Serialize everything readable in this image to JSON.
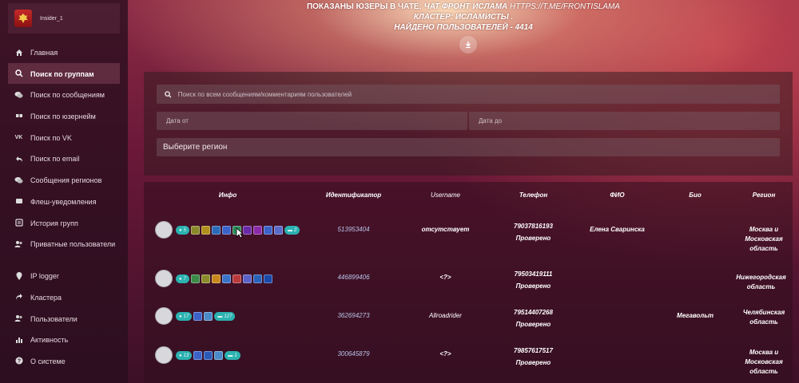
{
  "user": {
    "name": "Insider_1"
  },
  "sidebar": {
    "items": [
      {
        "label": "Главная",
        "icon": "home-icon"
      },
      {
        "label": "Поиск по группам",
        "icon": "search-icon",
        "active": true
      },
      {
        "label": "Поиск по сообщениям",
        "icon": "comments-icon"
      },
      {
        "label": "Поиск по юзернейм",
        "icon": "quote-icon"
      },
      {
        "label": "Поиск по VK",
        "icon": "vk-icon"
      },
      {
        "label": "Поиск по email",
        "icon": "reply-icon"
      },
      {
        "label": "Сообщения регионов",
        "icon": "chat-icon"
      },
      {
        "label": "Флеш-уведомления",
        "icon": "message-icon"
      },
      {
        "label": "История групп",
        "icon": "history-icon"
      },
      {
        "label": "Приватные пользователи",
        "icon": "users-icon"
      },
      {
        "label": "IP logger",
        "icon": "pin-icon"
      },
      {
        "label": "Кластера",
        "icon": "share-icon"
      },
      {
        "label": "Пользователи",
        "icon": "users-icon"
      },
      {
        "label": "Активность",
        "icon": "bar-chart-icon"
      },
      {
        "label": "О системе",
        "icon": "question-icon"
      }
    ]
  },
  "header": {
    "line1_prefix": "ПОКАЗАНЫ ЮЗЕРЫ В ЧАТЕ: ",
    "line1_chat": "ЧАТ ФРОНТ ИСЛАМА",
    "line1_url": " HTTPS://T.ME/FRONTISLAMA",
    "line2_prefix": "КЛАСТЕР: ",
    "line2_cluster": "ИСЛАМИСТЫ",
    "line2_suffix": " .",
    "line3": "НАЙДЕНО ПОЛЬЗОВАТЕЛЕЙ - 4414"
  },
  "filters": {
    "search_placeholder": "Поиск по всем сообщениям/комментариям пользователей",
    "date_from_placeholder": "Дата от",
    "date_to_placeholder": "Дата до",
    "region_label": "Выберите регион"
  },
  "table": {
    "headers": [
      "Инфо",
      "Идентификатор",
      "Username",
      "Телефон",
      "ФИО",
      "Био",
      "Регион"
    ],
    "rows": [
      {
        "messages": "5",
        "extra_badge": "2",
        "id": "513953404",
        "username": "отсутствует",
        "phone": "79037816193",
        "phone_status": "Проверено",
        "fio": "Елена Сваринска",
        "bio": "",
        "region": "Москва и Московская область",
        "icons": [
          "#8a8a2a",
          "#b0901a",
          "#2a6ab8",
          "#3a62c8",
          "#2a8a58",
          "#6a2aa8",
          "#8a2aa8",
          "#3a62c8",
          "#5a6ac8"
        ]
      },
      {
        "messages": "7",
        "extra_badge": "",
        "id": "446899406",
        "username": "<?>",
        "phone": "79503419111",
        "phone_status": "Проверено",
        "fio": "",
        "bio": "",
        "region": "Нижегородская область",
        "icons": [
          "#3a8a48",
          "#8a8a2a",
          "#c8881a",
          "#3a72c8",
          "#b83a3a",
          "#5a62c8",
          "#2a62b8",
          "#1a4aa8"
        ]
      },
      {
        "messages": "17",
        "extra_badge": "127",
        "id": "362694273",
        "username": "Allroadrider",
        "phone": "79514407268",
        "phone_status": "Проверено",
        "fio": "",
        "bio": "Мегавольт",
        "region": "Челябинская область",
        "icons": [
          "#3a62c8",
          "#4a8ac8"
        ]
      },
      {
        "messages": "13",
        "extra_badge": "1",
        "id": "300645879",
        "username": "<?>",
        "phone": "79857617517",
        "phone_status": "Проверено",
        "fio": "",
        "bio": "",
        "region": "Москва и Московская область",
        "icons": [
          "#3a62c8",
          "#2a5ab8",
          "#4a8ac8"
        ]
      }
    ]
  },
  "colors": {
    "accent_pill": "#2bb2b0",
    "id_link": "#b8c4e8"
  }
}
